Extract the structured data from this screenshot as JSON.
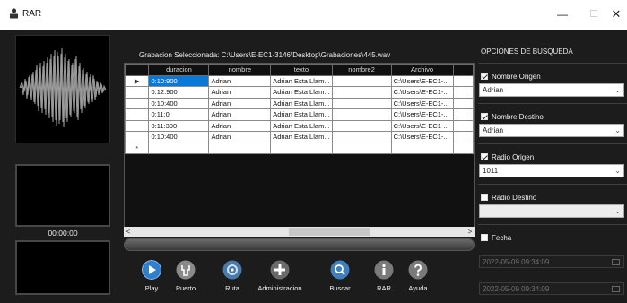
{
  "window": {
    "title": "RAR",
    "min_glyph": "—",
    "max_glyph": "☐",
    "close_glyph": "✕"
  },
  "player": {
    "timer": "00:00:00"
  },
  "selected_path": "Grabacion Seleccionada: C:\\Users\\E-EC1-3146\\Desktop\\Grabaciones\\445.wav",
  "grid": {
    "columns": [
      "duracion",
      "nombre",
      "texto",
      "nombre2",
      "Archivo"
    ],
    "rows": [
      [
        "0:10:900",
        "Adrian",
        "Adrian Esta Llam...",
        "",
        "C:\\Users\\E-EC1-..."
      ],
      [
        "0:12:900",
        "Adrian",
        "Adrian Esta Llam...",
        "",
        "C:\\Users\\E-EC1-..."
      ],
      [
        "0:10:400",
        "Adrian",
        "Adrian Esta Llam...",
        "",
        "C:\\Users\\E-EC1-..."
      ],
      [
        "0:11:0",
        "Adrian",
        "Adrian Esta Llam...",
        "",
        "C:\\Users\\E-EC1-..."
      ],
      [
        "0:11:300",
        "Adrian",
        "Adrian Esta Llam...",
        "",
        "C:\\Users\\E-EC1-..."
      ],
      [
        "0:10:400",
        "Adrian",
        "Adrian Esta Llam...",
        "",
        "C:\\Users\\E-EC1-..."
      ]
    ],
    "current_row_glyph": "▶",
    "new_row_glyph": "*"
  },
  "scroll": {
    "left": "<",
    "right": ">"
  },
  "toolbar": [
    {
      "name": "play",
      "label": "Play",
      "icon": "play-icon",
      "color": "#2f7fd0"
    },
    {
      "name": "puerto",
      "label": "Puerto",
      "icon": "port-icon",
      "color": "#8a8a8a"
    },
    {
      "name": "ruta",
      "label": "Ruta",
      "icon": "route-icon",
      "color": "#4a7aa8"
    },
    {
      "name": "administracion",
      "label": "Administracion",
      "icon": "plus-icon",
      "color": "#6a6a6a"
    },
    {
      "name": "buscar",
      "label": "Buscar",
      "icon": "search-icon",
      "color": "#3f7fbf"
    },
    {
      "name": "rar",
      "label": "RAR",
      "icon": "info-icon",
      "color": "#7a7a7a"
    },
    {
      "name": "ayuda",
      "label": "Ayuda",
      "icon": "help-icon",
      "color": "#7a7a7a"
    }
  ],
  "options": {
    "header": "OPCIONES DE BUSQUEDA",
    "nombre_origen": {
      "label": "Nombre Origen",
      "checked": true,
      "value": "Adrian"
    },
    "nombre_destino": {
      "label": "Nombre Destino",
      "checked": true,
      "value": "Adrian"
    },
    "radio_origen": {
      "label": "Radio Origen",
      "checked": true,
      "value": "1011"
    },
    "radio_destino": {
      "label": "Radio Destino",
      "checked": false,
      "value": ""
    },
    "fecha": {
      "label": "Fecha",
      "checked": false,
      "from": "2022-05-09 09:34:09",
      "to": "2022-05-09 09:34:09"
    },
    "chevron": "⌄"
  },
  "colors": {
    "background": "#1c1c1c",
    "selection": "#0a78d7"
  }
}
